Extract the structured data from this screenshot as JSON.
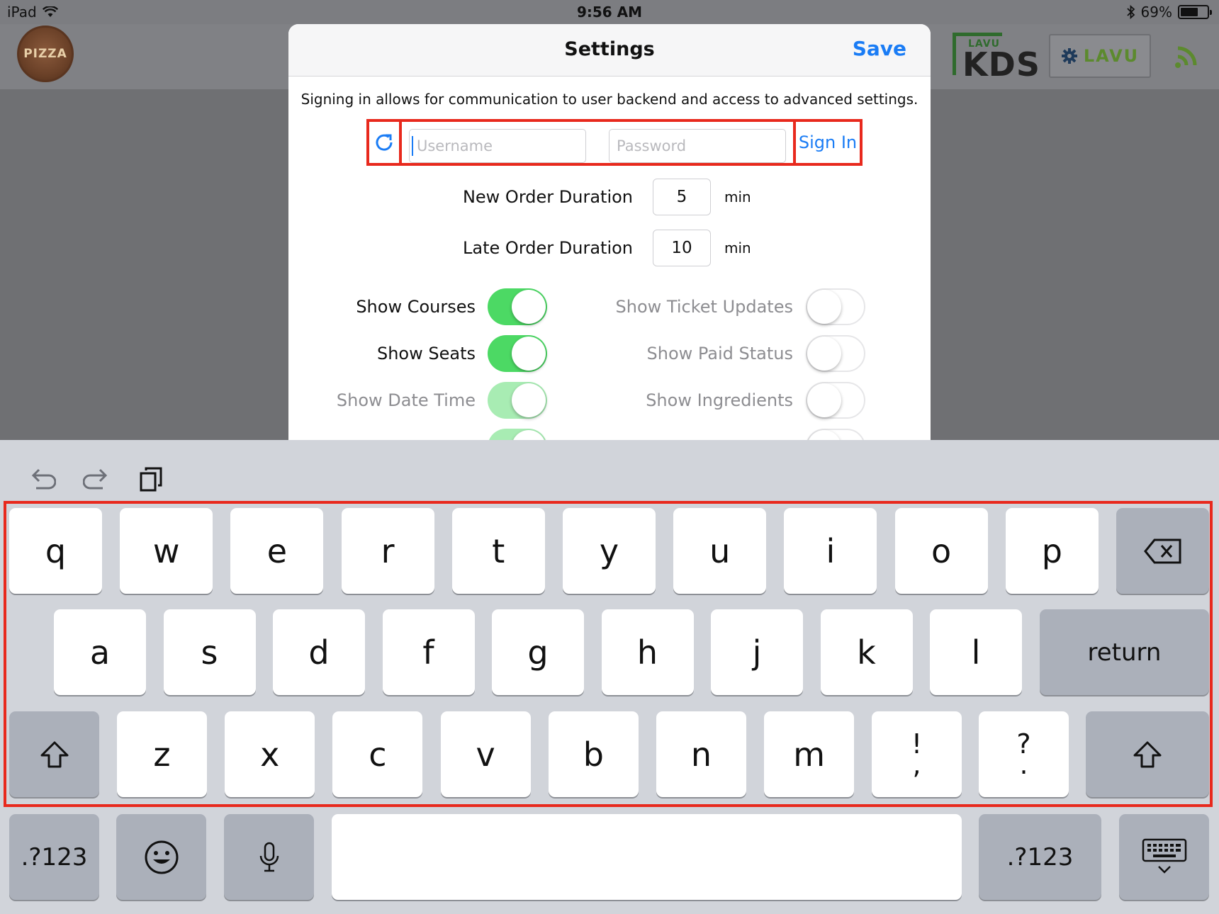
{
  "statusbar": {
    "device": "iPad",
    "time": "9:56 AM",
    "battery": "69%",
    "battery_level": 0.69
  },
  "header": {
    "pizza_logo": "PIZZA",
    "kds_small": "LAVU",
    "kds_big": "KDS",
    "lavu_button": "LAVU"
  },
  "settings": {
    "title": "Settings",
    "save_label": "Save",
    "info_text": "Signing in allows for communication to user backend and access to advanced settings.",
    "username_placeholder": "Username",
    "password_placeholder": "Password",
    "signin_label": "Sign In",
    "new_order": {
      "label": "New Order Duration",
      "value": "5",
      "unit": "min"
    },
    "late_order": {
      "label": "Late Order Duration",
      "value": "10",
      "unit": "min"
    },
    "toggles_left": [
      {
        "label": "Show Courses",
        "on": true,
        "enabled": true
      },
      {
        "label": "Show Seats",
        "on": true,
        "enabled": true
      },
      {
        "label": "Show Date Time",
        "on": true,
        "enabled": false
      }
    ],
    "toggles_right": [
      {
        "label": "Show Ticket Updates",
        "on": false,
        "enabled": false
      },
      {
        "label": "Show Paid Status",
        "on": false,
        "enabled": false
      },
      {
        "label": "Show Ingredients",
        "on": false,
        "enabled": false
      }
    ]
  },
  "keyboard": {
    "row1": [
      "q",
      "w",
      "e",
      "r",
      "t",
      "y",
      "u",
      "i",
      "o",
      "p"
    ],
    "row2": [
      "a",
      "s",
      "d",
      "f",
      "g",
      "h",
      "j",
      "k",
      "l"
    ],
    "row3": [
      "z",
      "x",
      "c",
      "v",
      "b",
      "n",
      "m"
    ],
    "punct1": {
      "top": "!",
      "bottom": ","
    },
    "punct2": {
      "top": "?",
      "bottom": "."
    },
    "return_label": "return",
    "numbers_label": ".?123"
  }
}
